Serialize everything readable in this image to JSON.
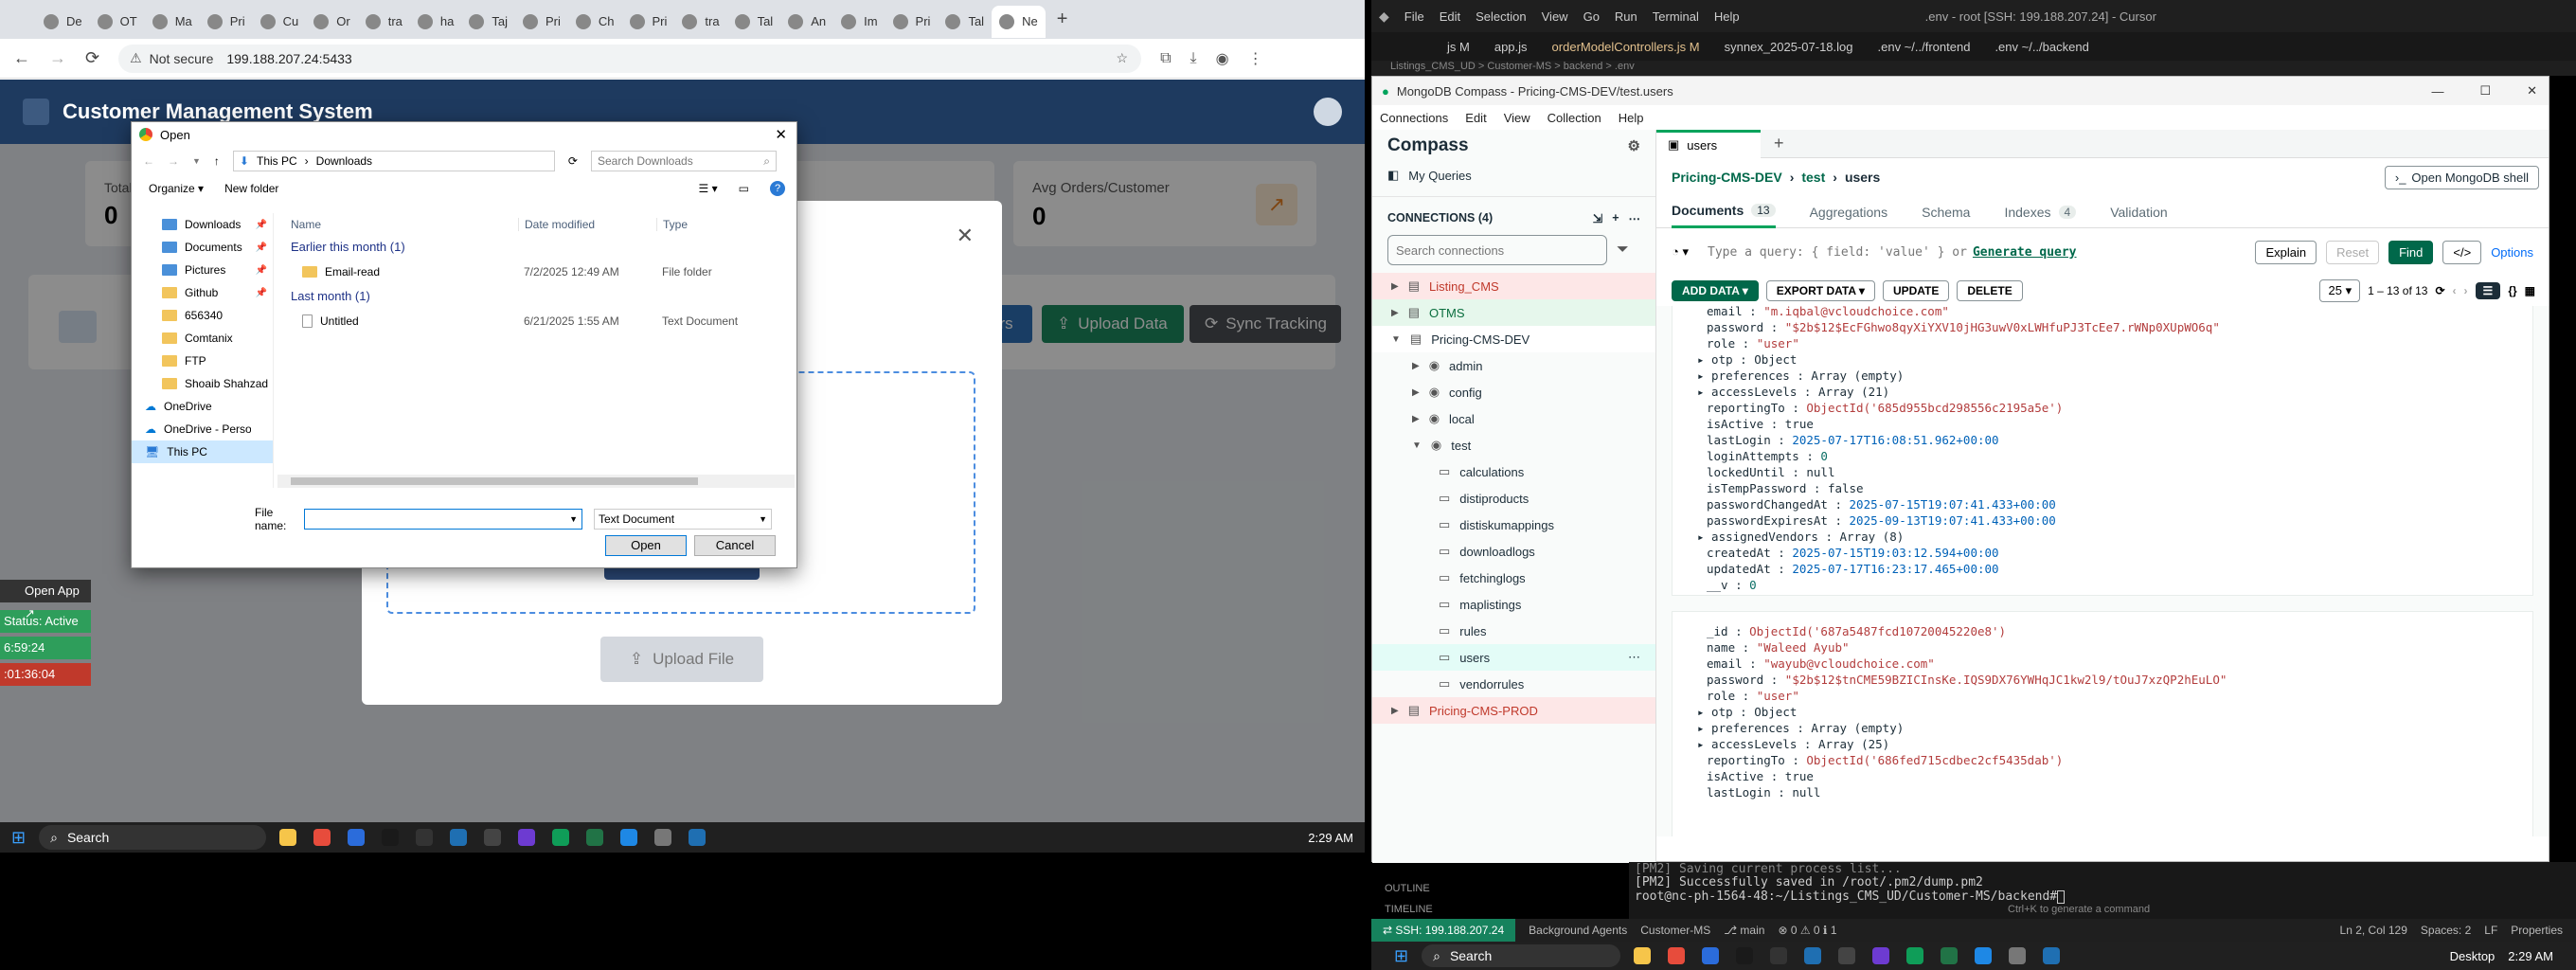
{
  "browser": {
    "tabs": [
      "De",
      "OT",
      "Ma",
      "Pri",
      "Cu",
      "Or",
      "tra",
      "ha",
      "Taj",
      "Pri",
      "Ch",
      "Pri",
      "tra",
      "Tal",
      "An",
      "Im",
      "Pri",
      "Tal",
      "Ne"
    ],
    "url": "199.188.207.24:5433",
    "not_secure": "Not secure"
  },
  "app": {
    "title": "Customer Management System",
    "stats": [
      {
        "label": "Total",
        "value": "0"
      },
      {
        "label": "Avg Orders/Customer",
        "value": "0"
      }
    ],
    "buttons": {
      "upload_data": "Upload Data",
      "sync_tracking": "Sync Tracking",
      "users": "ers",
      "upload_file": "Upload File"
    },
    "side_panel": {
      "open_app": "Open App ↗",
      "status": "Status: Active",
      "time1": "6:59:24",
      "time2": ":01:36:04"
    }
  },
  "dialog": {
    "title": "Open",
    "breadcrumb": [
      "This PC",
      "Downloads"
    ],
    "search_placeholder": "Search Downloads",
    "organize": "Organize",
    "new_folder": "New folder",
    "columns": [
      "Name",
      "Date modified",
      "Type"
    ],
    "tree": [
      {
        "label": "Downloads",
        "pinned": true
      },
      {
        "label": "Documents",
        "pinned": true
      },
      {
        "label": "Pictures",
        "pinned": true
      },
      {
        "label": "Github",
        "pinned": true
      },
      {
        "label": "656340",
        "pinned": false
      },
      {
        "label": "Comtanix",
        "pinned": false
      },
      {
        "label": "FTP",
        "pinned": false
      },
      {
        "label": "Shoaib Shahzad",
        "pinned": false
      },
      {
        "label": "OneDrive",
        "pinned": false
      },
      {
        "label": "OneDrive - Person",
        "pinned": false
      },
      {
        "label": "This PC",
        "pinned": false
      }
    ],
    "groups": [
      {
        "header": "Earlier this month (1)",
        "files": [
          {
            "name": "Email-read",
            "date": "7/2/2025 12:49 AM",
            "type": "File folder"
          }
        ]
      },
      {
        "header": "Last month (1)",
        "files": [
          {
            "name": "Untitled",
            "date": "6/21/2025 1:55 AM",
            "type": "Text Document"
          }
        ]
      }
    ],
    "filename_label": "File name:",
    "filename_value": "",
    "filetype": "Text Document",
    "open_btn": "Open",
    "cancel_btn": "Cancel"
  },
  "taskbar_left": {
    "search": "Search",
    "time": "2:29 AM"
  },
  "vscode": {
    "menu": [
      "File",
      "Edit",
      "Selection",
      "View",
      "Go",
      "Run",
      "Terminal",
      "Help"
    ],
    "title": ".env - root [SSH: 199.188.207.24] - Cursor",
    "tabs": [
      "js M",
      "app.js",
      "orderModelControllers.js M",
      "synnex_2025-07-18.log",
      ".env ~/../frontend",
      ".env ~/../backend"
    ],
    "breadcrumb": "Listings_CMS_UD > Customer-MS > backend > .env"
  },
  "compass": {
    "window_title": "MongoDB Compass - Pricing-CMS-DEV/test.users",
    "menu": [
      "Connections",
      "Edit",
      "View",
      "Collection",
      "Help"
    ],
    "brand": "Compass",
    "my_queries": "My Queries",
    "connections_label": "CONNECTIONS (4)",
    "search_connections": "Search connections",
    "connections": [
      {
        "name": "Listing_CMS",
        "color": "#fde7e7",
        "expanded": false
      },
      {
        "name": "OTMS",
        "color": "#e6f7ec",
        "expanded": false
      },
      {
        "name": "Pricing-CMS-DEV",
        "color": "#ffffff",
        "expanded": true
      },
      {
        "name": "Pricing-CMS-PROD",
        "color": "#fde7e7",
        "expanded": false
      }
    ],
    "databases": [
      "admin",
      "config",
      "local",
      "test"
    ],
    "collections": [
      "calculations",
      "distiproducts",
      "distiskumappings",
      "downloadlogs",
      "fetchinglogs",
      "maplistings",
      "rules",
      "users",
      "vendorrules"
    ],
    "active_tab": "users",
    "crumb": [
      "Pricing-CMS-DEV",
      "test",
      "users"
    ],
    "open_shell": "Open MongoDB shell",
    "subtabs": [
      {
        "label": "Documents",
        "count": "13"
      },
      {
        "label": "Aggregations",
        "count": ""
      },
      {
        "label": "Schema",
        "count": ""
      },
      {
        "label": "Indexes",
        "count": "4"
      },
      {
        "label": "Validation",
        "count": ""
      }
    ],
    "query_placeholder": "Type a query: { field: 'value' } or",
    "generate_query": "Generate query",
    "explain": "Explain",
    "reset": "Reset",
    "find": "Find",
    "options": "Options",
    "toolbar": {
      "add_data": "ADD DATA",
      "export_data": "EXPORT DATA",
      "update": "UPDATE",
      "delete": "DELETE",
      "page_size": "25",
      "range": "1 – 13 of 13"
    },
    "doc1": [
      [
        "email",
        "\"m.iqbal@vcloudchoice.com\"",
        "s"
      ],
      [
        "password",
        "\"$2b$12$EcFGhwo8qyXiYXV10jHG3uwV0xLWHfuPJ3TcEe7.rWNp0XUpWO6q\"",
        "s"
      ],
      [
        "role",
        "\"user\"",
        "s"
      ],
      [
        "▸ otp",
        "Object",
        "o"
      ],
      [
        "▸ preferences",
        "Array (empty)",
        "o"
      ],
      [
        "▸ accessLevels",
        "Array (21)",
        "o"
      ],
      [
        "reportingTo",
        "ObjectId('685d955bcd298556c2195a5e')",
        "s"
      ],
      [
        "isActive",
        "true",
        "o"
      ],
      [
        "lastLogin",
        "2025-07-17T16:08:51.962+00:00",
        "d"
      ],
      [
        "loginAttempts",
        "0",
        "n"
      ],
      [
        "lockedUntil",
        "null",
        "o"
      ],
      [
        "isTempPassword",
        "false",
        "o"
      ],
      [
        "passwordChangedAt",
        "2025-07-15T19:07:41.433+00:00",
        "d"
      ],
      [
        "passwordExpiresAt",
        "2025-09-13T19:07:41.433+00:00",
        "d"
      ],
      [
        "▸ assignedVendors",
        "Array (8)",
        "o"
      ],
      [
        "createdAt",
        "2025-07-15T19:03:12.594+00:00",
        "d"
      ],
      [
        "updatedAt",
        "2025-07-17T16:23:17.465+00:00",
        "d"
      ],
      [
        "__v",
        "0",
        "n"
      ]
    ],
    "doc2": [
      [
        "_id",
        "ObjectId('687a5487fcd10720045220e8')",
        "s"
      ],
      [
        "name",
        "\"Waleed Ayub\"",
        "s"
      ],
      [
        "email",
        "\"wayub@vcloudchoice.com\"",
        "s"
      ],
      [
        "password",
        "\"$2b$12$tnCME59BZICInsKe.IQS9DX76YWHqJC1kw2l9/tOuJ7xzQP2hEuLO\"",
        "s"
      ],
      [
        "role",
        "\"user\"",
        "s"
      ],
      [
        "▸ otp",
        "Object",
        "o"
      ],
      [
        "▸ preferences",
        "Array (empty)",
        "o"
      ],
      [
        "▸ accessLevels",
        "Array (25)",
        "o"
      ],
      [
        "reportingTo",
        "ObjectId('686fed715cdbec2cf5435dab')",
        "s"
      ],
      [
        "isActive",
        "true",
        "o"
      ],
      [
        "lastLogin",
        "null",
        "o"
      ]
    ]
  },
  "terminal": {
    "line1": "[PM2] Saving current process list...",
    "line2": "[PM2] Successfully saved in /root/.pm2/dump.pm2",
    "prompt": "root@nc-ph-1564-48:~/Listings_CMS_UD/Customer-MS/backend# ",
    "hint": "Ctrl+K to generate a command"
  },
  "statusbar": {
    "ssh": "SSH: 199.188.207.24",
    "agents": "Background Agents",
    "project": "Customer-MS",
    "branch": "main",
    "problems": "⊗ 0 ⚠ 0 ℹ 1",
    "cursor": "Ln 2, Col 129",
    "spaces": "Spaces: 2",
    "eol": "LF",
    "props": "Properties",
    "outline": "OUTLINE",
    "timeline": "TIMELINE"
  },
  "taskbar_right": {
    "search": "Search",
    "desktop": "Desktop",
    "time": "2:29 AM"
  }
}
